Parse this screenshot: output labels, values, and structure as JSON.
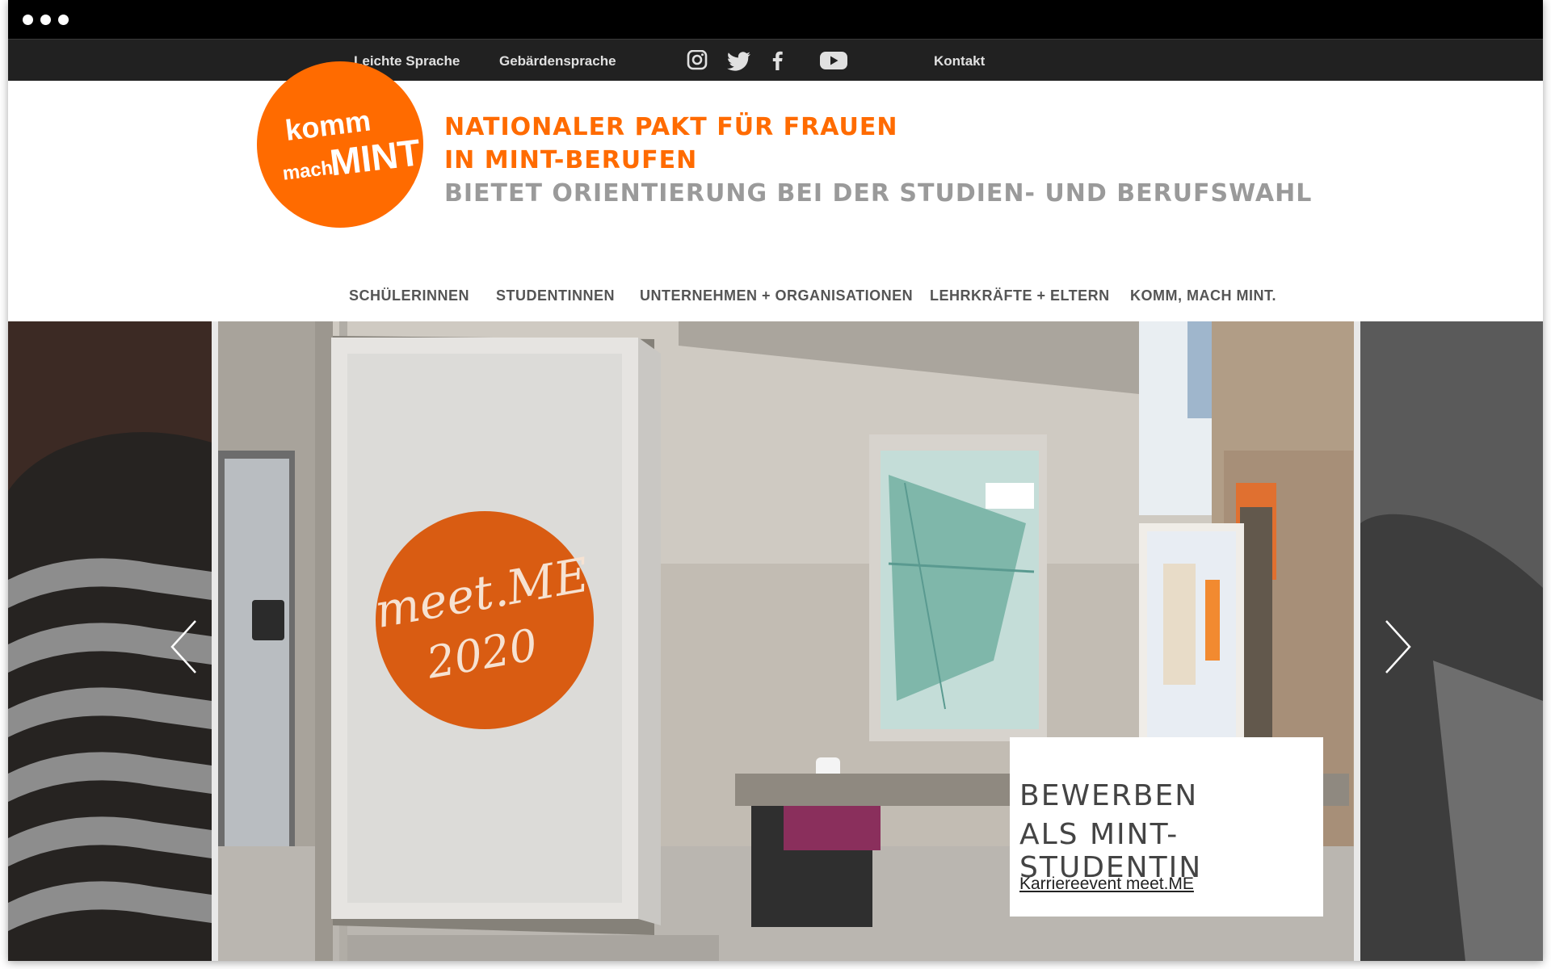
{
  "topbar": {
    "links": [
      "Leichte Sprache",
      "Gebärdensprache"
    ],
    "contact": "Kontakt",
    "social_icons": [
      "instagram-icon",
      "twitter-icon",
      "facebook-icon",
      "youtube-icon"
    ]
  },
  "logo": {
    "line1": "komm",
    "line2a": "mach",
    "line2b": "MINT",
    "color": "#ff6b00"
  },
  "tagline": {
    "line1": "NATIONALER PAKT FÜR FRAUEN",
    "line2": "IN MINT-BERUFEN",
    "line3": "BIETET ORIENTIERUNG BEI DER STUDIEN- UND BERUFSWAHL"
  },
  "nav": {
    "items": [
      "SCHÜLERINNEN",
      "STUDENTINNEN",
      "UNTERNEHMEN + ORGANISATIONEN",
      "LEHRKRÄFTE + ELTERN",
      "KOMM, MACH MINT."
    ]
  },
  "slide": {
    "poster_line1": "meet.ME",
    "poster_line2": "2020",
    "cta_line1": "BEWERBEN",
    "cta_line2": "ALS MINT-STUDENTIN",
    "cta_link": "Karriereevent meet.ME"
  },
  "colors": {
    "accent": "#ff6b00",
    "topbar": "#212121",
    "nav_text": "#555555",
    "subtitle": "#9a9a9a"
  }
}
